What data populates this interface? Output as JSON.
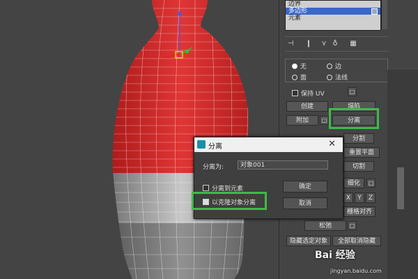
{
  "list": {
    "items": [
      {
        "label": "边界"
      },
      {
        "label": "多边形"
      },
      {
        "label": "元素"
      }
    ]
  },
  "toolbar_icons": [
    "pin-icon",
    "bar-icon",
    "fork-icon",
    "funnel-icon",
    "grid-icon"
  ],
  "panel": {
    "radio_none": "无",
    "radio_edge": "边",
    "radio_face": "面",
    "radio_normal": "法线",
    "preserve_uv": "保持 UV",
    "create": "创建",
    "collapse": "塌陷",
    "attach": "附加",
    "detach": "分离",
    "slice": "分割",
    "reset_plane": "重置平面",
    "cut": "切割",
    "refine": "细化",
    "x": "X",
    "y": "Y",
    "z": "Z",
    "align_grid": "栅格对齐",
    "relax": "松弛",
    "hide_selected": "隐藏选定对象",
    "unhide_all": "全部取消隐藏"
  },
  "dialog": {
    "title": "分离",
    "close": "✕",
    "detach_as_label": "分离为:",
    "detach_as_value": "对象001",
    "detach_to_element": "分离到元素",
    "detach_as_clone": "以克隆对象分离",
    "ok": "确定",
    "cancel": "取消"
  },
  "watermark": {
    "brand": "Bai 经验",
    "url": "jingyan.baidu.com"
  },
  "colors": {
    "highlight": "#3dbb4a",
    "mesh_red": "#d42a2a",
    "selected_row": "#3a67c8"
  }
}
